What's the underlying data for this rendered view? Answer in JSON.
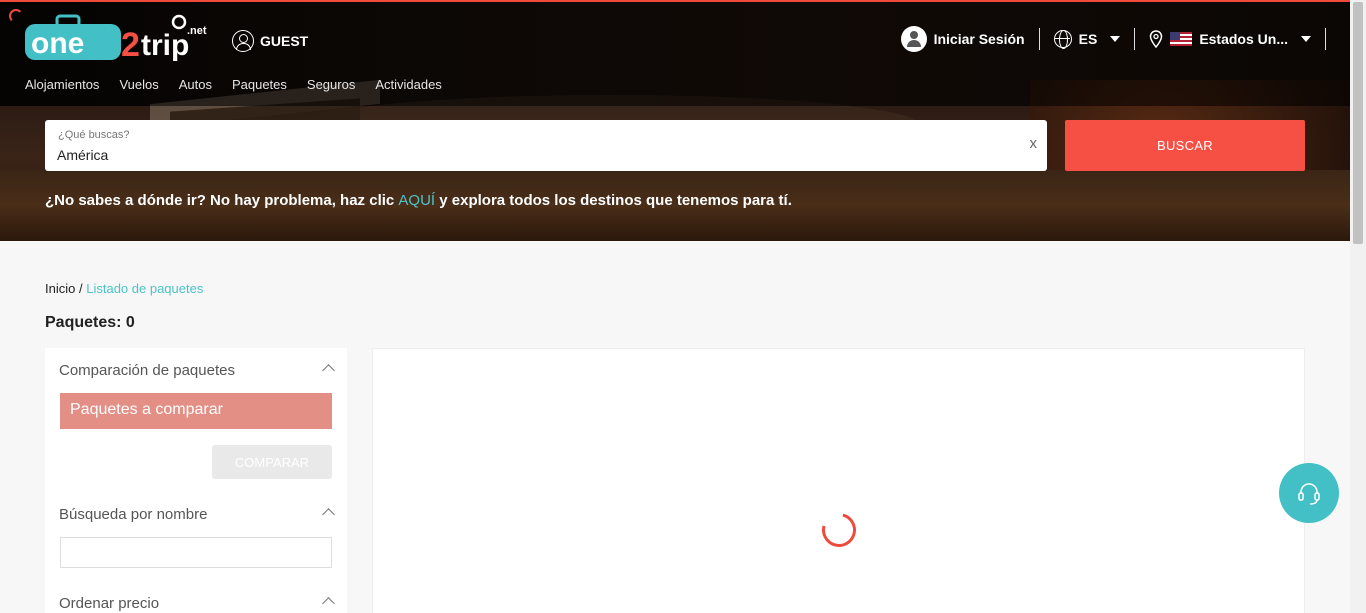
{
  "colors": {
    "accent": "#f64f44",
    "teal": "#4cc3c9",
    "compare_bar": "#e38f85"
  },
  "header": {
    "logo_text": "one2trip",
    "logo_suffix": ".net",
    "guest_label": "GUEST",
    "login_label": "Iniciar Sesión",
    "language": "ES",
    "country": "Estados Un..."
  },
  "nav": {
    "items": [
      "Alojamientos",
      "Vuelos",
      "Autos",
      "Paquetes",
      "Seguros",
      "Actividades"
    ]
  },
  "search": {
    "label": "¿Qué buscas?",
    "value": "América",
    "clear": "x",
    "button": "BUSCAR"
  },
  "promo": {
    "before": "¿No sabes a dónde ir? No hay problema, haz clic ",
    "link": "AQUÍ",
    "after": " y explora todos los destinos que tenemos para tí."
  },
  "breadcrumb": {
    "home": "Inicio",
    "separator": "/",
    "current": "Listado de paquetes"
  },
  "results": {
    "count_label": "Paquetes: 0"
  },
  "sidebar": {
    "compare_title": "Comparación de paquetes",
    "compare_bar": "Paquetes a comparar",
    "compare_button": "COMPARAR",
    "name_search_title": "Búsqueda por nombre",
    "name_search_value": "",
    "price_sort_title": "Ordenar precio"
  }
}
